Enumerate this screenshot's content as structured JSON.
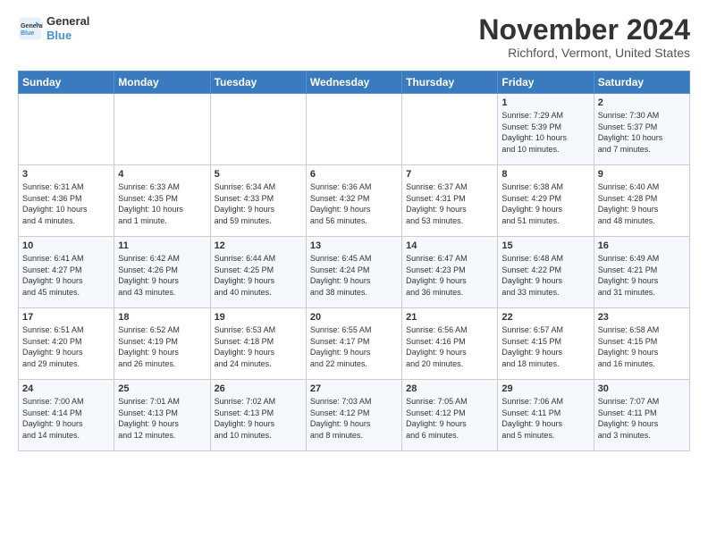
{
  "logo": {
    "line1": "General",
    "line2": "Blue"
  },
  "title": "November 2024",
  "subtitle": "Richford, Vermont, United States",
  "days_header": [
    "Sunday",
    "Monday",
    "Tuesday",
    "Wednesday",
    "Thursday",
    "Friday",
    "Saturday"
  ],
  "weeks": [
    [
      {
        "day": "",
        "info": ""
      },
      {
        "day": "",
        "info": ""
      },
      {
        "day": "",
        "info": ""
      },
      {
        "day": "",
        "info": ""
      },
      {
        "day": "",
        "info": ""
      },
      {
        "day": "1",
        "info": "Sunrise: 7:29 AM\nSunset: 5:39 PM\nDaylight: 10 hours\nand 10 minutes."
      },
      {
        "day": "2",
        "info": "Sunrise: 7:30 AM\nSunset: 5:37 PM\nDaylight: 10 hours\nand 7 minutes."
      }
    ],
    [
      {
        "day": "3",
        "info": "Sunrise: 6:31 AM\nSunset: 4:36 PM\nDaylight: 10 hours\nand 4 minutes."
      },
      {
        "day": "4",
        "info": "Sunrise: 6:33 AM\nSunset: 4:35 PM\nDaylight: 10 hours\nand 1 minute."
      },
      {
        "day": "5",
        "info": "Sunrise: 6:34 AM\nSunset: 4:33 PM\nDaylight: 9 hours\nand 59 minutes."
      },
      {
        "day": "6",
        "info": "Sunrise: 6:36 AM\nSunset: 4:32 PM\nDaylight: 9 hours\nand 56 minutes."
      },
      {
        "day": "7",
        "info": "Sunrise: 6:37 AM\nSunset: 4:31 PM\nDaylight: 9 hours\nand 53 minutes."
      },
      {
        "day": "8",
        "info": "Sunrise: 6:38 AM\nSunset: 4:29 PM\nDaylight: 9 hours\nand 51 minutes."
      },
      {
        "day": "9",
        "info": "Sunrise: 6:40 AM\nSunset: 4:28 PM\nDaylight: 9 hours\nand 48 minutes."
      }
    ],
    [
      {
        "day": "10",
        "info": "Sunrise: 6:41 AM\nSunset: 4:27 PM\nDaylight: 9 hours\nand 45 minutes."
      },
      {
        "day": "11",
        "info": "Sunrise: 6:42 AM\nSunset: 4:26 PM\nDaylight: 9 hours\nand 43 minutes."
      },
      {
        "day": "12",
        "info": "Sunrise: 6:44 AM\nSunset: 4:25 PM\nDaylight: 9 hours\nand 40 minutes."
      },
      {
        "day": "13",
        "info": "Sunrise: 6:45 AM\nSunset: 4:24 PM\nDaylight: 9 hours\nand 38 minutes."
      },
      {
        "day": "14",
        "info": "Sunrise: 6:47 AM\nSunset: 4:23 PM\nDaylight: 9 hours\nand 36 minutes."
      },
      {
        "day": "15",
        "info": "Sunrise: 6:48 AM\nSunset: 4:22 PM\nDaylight: 9 hours\nand 33 minutes."
      },
      {
        "day": "16",
        "info": "Sunrise: 6:49 AM\nSunset: 4:21 PM\nDaylight: 9 hours\nand 31 minutes."
      }
    ],
    [
      {
        "day": "17",
        "info": "Sunrise: 6:51 AM\nSunset: 4:20 PM\nDaylight: 9 hours\nand 29 minutes."
      },
      {
        "day": "18",
        "info": "Sunrise: 6:52 AM\nSunset: 4:19 PM\nDaylight: 9 hours\nand 26 minutes."
      },
      {
        "day": "19",
        "info": "Sunrise: 6:53 AM\nSunset: 4:18 PM\nDaylight: 9 hours\nand 24 minutes."
      },
      {
        "day": "20",
        "info": "Sunrise: 6:55 AM\nSunset: 4:17 PM\nDaylight: 9 hours\nand 22 minutes."
      },
      {
        "day": "21",
        "info": "Sunrise: 6:56 AM\nSunset: 4:16 PM\nDaylight: 9 hours\nand 20 minutes."
      },
      {
        "day": "22",
        "info": "Sunrise: 6:57 AM\nSunset: 4:15 PM\nDaylight: 9 hours\nand 18 minutes."
      },
      {
        "day": "23",
        "info": "Sunrise: 6:58 AM\nSunset: 4:15 PM\nDaylight: 9 hours\nand 16 minutes."
      }
    ],
    [
      {
        "day": "24",
        "info": "Sunrise: 7:00 AM\nSunset: 4:14 PM\nDaylight: 9 hours\nand 14 minutes."
      },
      {
        "day": "25",
        "info": "Sunrise: 7:01 AM\nSunset: 4:13 PM\nDaylight: 9 hours\nand 12 minutes."
      },
      {
        "day": "26",
        "info": "Sunrise: 7:02 AM\nSunset: 4:13 PM\nDaylight: 9 hours\nand 10 minutes."
      },
      {
        "day": "27",
        "info": "Sunrise: 7:03 AM\nSunset: 4:12 PM\nDaylight: 9 hours\nand 8 minutes."
      },
      {
        "day": "28",
        "info": "Sunrise: 7:05 AM\nSunset: 4:12 PM\nDaylight: 9 hours\nand 6 minutes."
      },
      {
        "day": "29",
        "info": "Sunrise: 7:06 AM\nSunset: 4:11 PM\nDaylight: 9 hours\nand 5 minutes."
      },
      {
        "day": "30",
        "info": "Sunrise: 7:07 AM\nSunset: 4:11 PM\nDaylight: 9 hours\nand 3 minutes."
      }
    ]
  ]
}
